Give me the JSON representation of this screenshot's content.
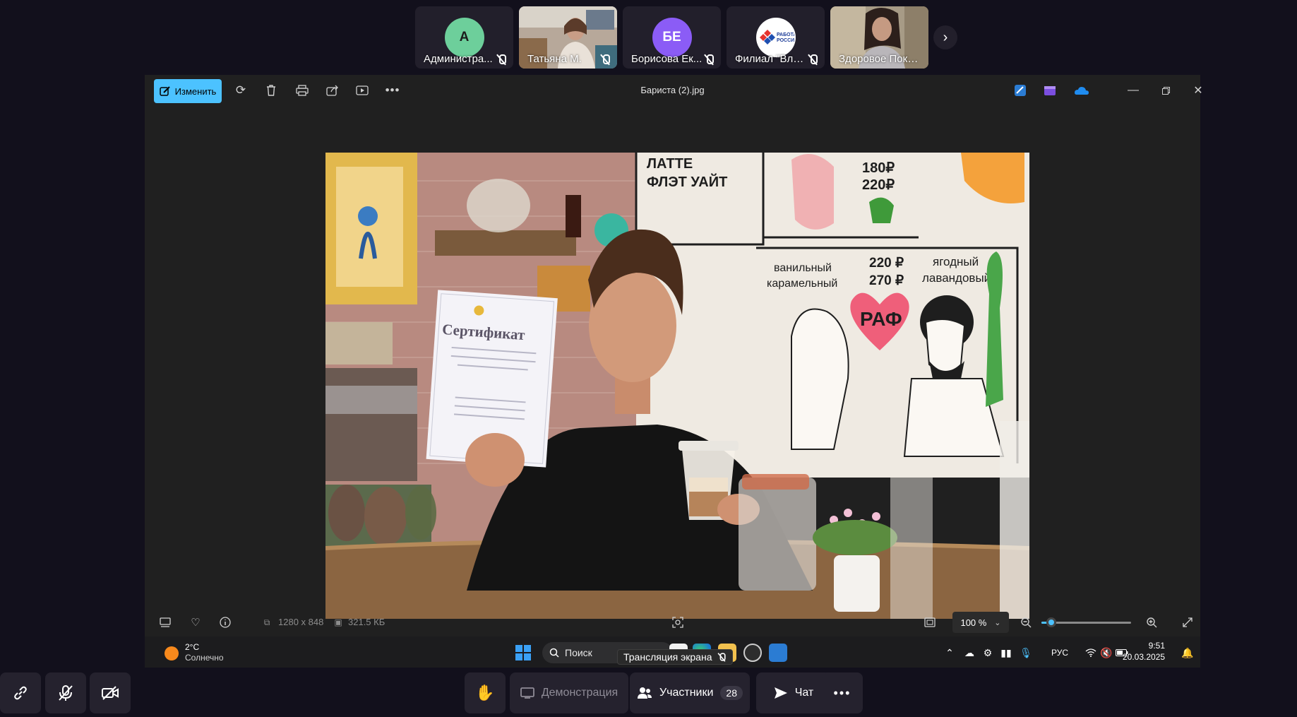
{
  "participants": [
    {
      "name": "Администра...",
      "initials": "А",
      "avatar_color": "#6dcf9b",
      "type": "avatar"
    },
    {
      "name": "Татьяна М.",
      "initials": "",
      "avatar_color": "",
      "type": "video"
    },
    {
      "name": "Борисова Ек...",
      "initials": "БЕ",
      "avatar_color": "#8b5cf6",
      "type": "avatar"
    },
    {
      "name": "Филиал \"Вла...",
      "initials": "",
      "avatar_color": "#ffffff",
      "type": "logo",
      "logo_text": "РАБОТА РОССИИ"
    },
    {
      "name": "Здоровое Поко...",
      "initials": "",
      "avatar_color": "",
      "type": "video",
      "active": true
    }
  ],
  "viewer": {
    "edit_label": "Изменить",
    "file_title": "Бариста (2).jpg",
    "dimensions": "1280 x 848",
    "file_size": "321.5 КБ",
    "zoom_value": "100 %",
    "zoom_fraction": 0.11,
    "photo_texts": {
      "certificate": "Сертификат",
      "wall_1": "ЛАТТЕ",
      "wall_2": "ФЛЭТ УАЙТ",
      "wall_price_1": "180₽",
      "wall_price_2": "220₽",
      "wall_3": "ванильный",
      "wall_4": "карамельный",
      "wall_5": "220 ₽",
      "wall_6": "270 ₽",
      "wall_7": "ягодный",
      "wall_8": "лавандовый",
      "wall_raf": "РАФ"
    }
  },
  "taskbar": {
    "temperature": "2°C",
    "weather": "Солнечно",
    "search": "Поиск",
    "tooltip": "Трансляция экрана",
    "language": "РУС",
    "time": "9:51",
    "date": "20.03.2025"
  },
  "controls": {
    "demo_label": "Демонстрация",
    "participants_label": "Участники",
    "participants_count": "28",
    "chat_label": "Чат"
  },
  "colors": {
    "accent": "#4cc2ff",
    "active_tile": "#f6c012",
    "background": "#12101c"
  }
}
